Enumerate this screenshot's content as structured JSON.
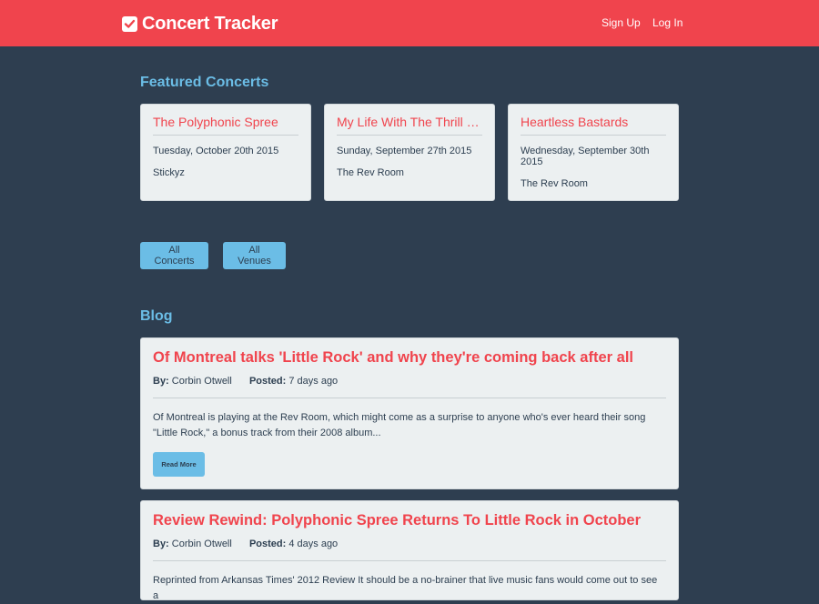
{
  "header": {
    "brand": "Concert Tracker",
    "brand_icon": "check-square-icon",
    "nav": {
      "sign_up": "Sign Up",
      "log_in": "Log In"
    },
    "background": "#f0444d"
  },
  "featured": {
    "title": "Featured Concerts",
    "concerts": [
      {
        "name": "The Polyphonic Spree",
        "date": "Tuesday, October 20th 2015",
        "venue": "Stickyz"
      },
      {
        "name": "My Life With The Thrill K...",
        "date": "Sunday, September 27th 2015",
        "venue": "The Rev Room"
      },
      {
        "name": "Heartless Bastards",
        "date": "Wednesday, September 30th 2015",
        "venue": "The Rev Room"
      }
    ]
  },
  "actions": {
    "all_concerts": "All Concerts",
    "all_venues": "All Venues"
  },
  "blog": {
    "title": "Blog",
    "by_label": "By:",
    "posted_label": "Posted:",
    "posts": [
      {
        "title": "Of Montreal talks 'Little Rock' and why they're coming back after all",
        "author": "Corbin Otwell",
        "posted": "7 days ago",
        "excerpt": "Of Montreal is playing at the Rev Room, which might come as a surprise to anyone who's ever heard their song \"Little Rock,\" a bonus track from their 2008 album...",
        "read_more": "Read More"
      },
      {
        "title": "Review Rewind: Polyphonic Spree Returns To Little Rock in October",
        "author": "Corbin Otwell",
        "posted": "4 days ago",
        "excerpt": "Reprinted from Arkansas Times' 2012 Review It should be a no-brainer that live music fans would come out to see a"
      }
    ]
  },
  "colors": {
    "page_bg": "#2e3e50",
    "accent_red": "#f0444d",
    "accent_blue": "#6bbde6",
    "card_bg": "#ecf0f1"
  }
}
